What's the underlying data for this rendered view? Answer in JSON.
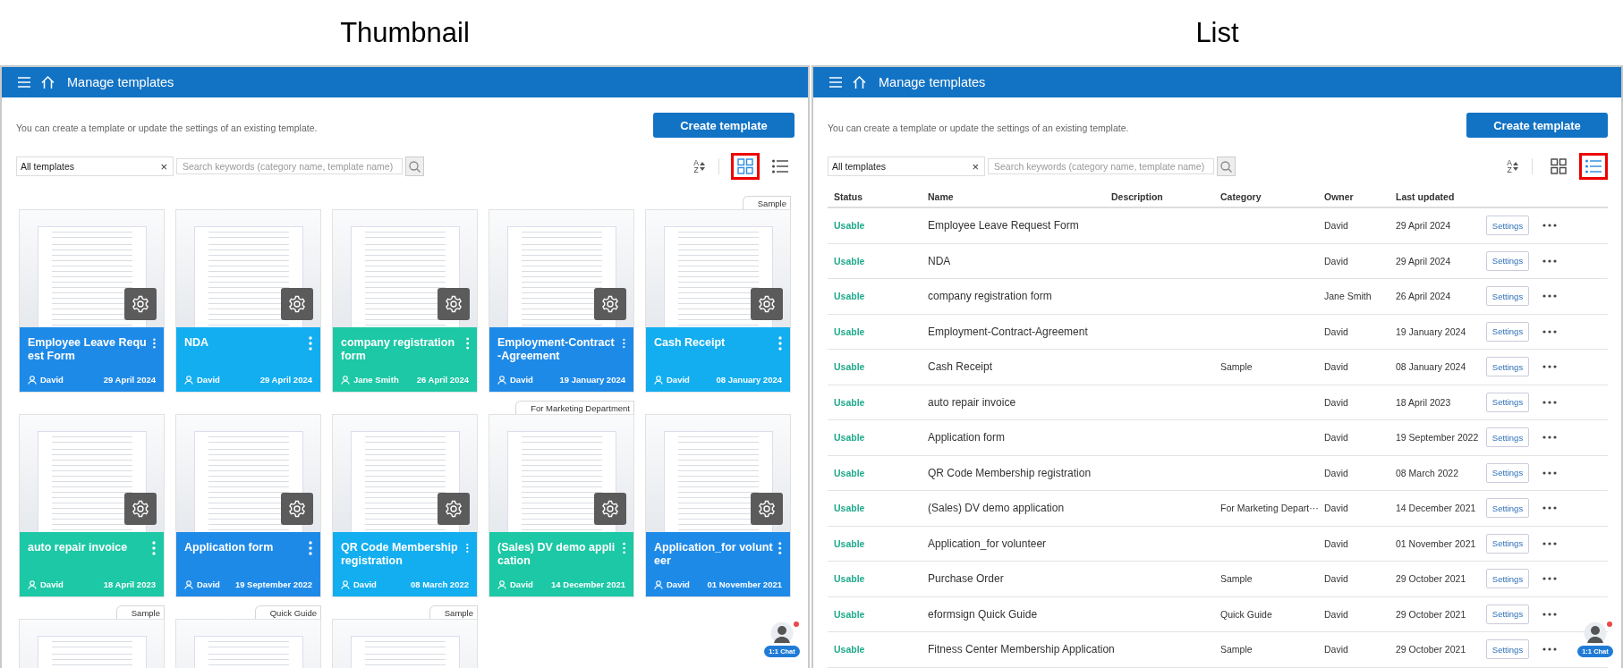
{
  "panels": [
    {
      "caption": "Thumbnail",
      "kind": "thumbnail",
      "header": {
        "title": "Manage templates"
      },
      "intro": "You can create a template or update the settings of an existing template.",
      "create_button": "Create template",
      "filter": {
        "value": "All templates",
        "clear": "×"
      },
      "search": {
        "placeholder": "Search keywords (category name, template name)"
      },
      "sort": {
        "top": "A",
        "bottom": "Z"
      },
      "view_buttons": [
        {
          "kind": "grid",
          "selected": true
        },
        {
          "kind": "list",
          "selected": false
        }
      ],
      "cards": [
        {
          "title": "Employee Leave Request Form",
          "owner": "David",
          "date": "29 April 2024",
          "color": "#1e8ae8"
        },
        {
          "title": "NDA",
          "owner": "David",
          "date": "29 April 2024",
          "color": "#12aef0"
        },
        {
          "title": "company registration form",
          "owner": "Jane Smith",
          "date": "26 April 2024",
          "color": "#1cc8a5"
        },
        {
          "title": "Employment-Contract-Agreement",
          "owner": "David",
          "date": "19 January 2024",
          "color": "#1e8ae8"
        },
        {
          "title": "Cash Receipt",
          "owner": "David",
          "date": "08 January 2024",
          "color": "#12aef0",
          "tag": "Sample"
        },
        {
          "title": "auto repair invoice",
          "owner": "David",
          "date": "18 April 2023",
          "color": "#1cc8a5"
        },
        {
          "title": "Application form",
          "owner": "David",
          "date": "19 September 2022",
          "color": "#1e8ae8"
        },
        {
          "title": "QR Code Membership registration",
          "owner": "David",
          "date": "08 March 2022",
          "color": "#12aef0"
        },
        {
          "title": "(Sales) DV demo application",
          "owner": "David",
          "date": "14 December 2021",
          "color": "#1cc8a5",
          "tag": "For Marketing Department"
        },
        {
          "title": "Application_for volunteer",
          "owner": "David",
          "date": "01 November 2021",
          "color": "#1e8ae8"
        },
        {
          "tag": "Sample"
        },
        {
          "tag": "Quick Guide"
        },
        {
          "tag": "Sample"
        }
      ],
      "chat": {
        "label": "1:1 Chat"
      }
    },
    {
      "caption": "List",
      "kind": "list",
      "header": {
        "title": "Manage templates"
      },
      "intro": "You can create a template or update the settings of an existing template.",
      "create_button": "Create template",
      "filter": {
        "value": "All templates",
        "clear": "×"
      },
      "search": {
        "placeholder": "Search keywords (category name, template name)"
      },
      "sort": {
        "top": "A",
        "bottom": "Z"
      },
      "view_buttons": [
        {
          "kind": "grid",
          "selected": false
        },
        {
          "kind": "list",
          "selected": true
        }
      ],
      "table": {
        "columns": [
          "Status",
          "Name",
          "Description",
          "Category",
          "Owner",
          "Last updated"
        ],
        "rows": [
          {
            "status": "Usable",
            "name": "Employee Leave Request Form",
            "owner": "David",
            "updated": "29 April 2024",
            "action": "Settings"
          },
          {
            "status": "Usable",
            "name": "NDA",
            "owner": "David",
            "updated": "29 April 2024",
            "action": "Settings"
          },
          {
            "status": "Usable",
            "name": "company registration form",
            "owner": "Jane Smith",
            "updated": "26 April 2024",
            "action": "Settings"
          },
          {
            "status": "Usable",
            "name": "Employment-Contract-Agreement",
            "owner": "David",
            "updated": "19 January 2024",
            "action": "Settings"
          },
          {
            "status": "Usable",
            "name": "Cash Receipt",
            "category": "Sample",
            "owner": "David",
            "updated": "08 January 2024",
            "action": "Settings"
          },
          {
            "status": "Usable",
            "name": "auto repair invoice",
            "owner": "David",
            "updated": "18 April 2023",
            "action": "Settings"
          },
          {
            "status": "Usable",
            "name": "Application form",
            "owner": "David",
            "updated": "19 September 2022",
            "action": "Settings"
          },
          {
            "status": "Usable",
            "name": "QR Code Membership registration",
            "owner": "David",
            "updated": "08 March 2022",
            "action": "Settings"
          },
          {
            "status": "Usable",
            "name": "(Sales) DV demo application",
            "category": "For Marketing Depart···",
            "owner": "David",
            "updated": "14 December 2021",
            "action": "Settings"
          },
          {
            "status": "Usable",
            "name": "Application_for volunteer",
            "owner": "David",
            "updated": "01 November 2021",
            "action": "Settings"
          },
          {
            "status": "Usable",
            "name": "Purchase Order",
            "category": "Sample",
            "owner": "David",
            "updated": "29 October 2021",
            "action": "Settings"
          },
          {
            "status": "Usable",
            "name": "eformsign Quick Guide",
            "category": "Quick Guide",
            "owner": "David",
            "updated": "29 October 2021",
            "action": "Settings"
          },
          {
            "status": "Usable",
            "name": "Fitness Center Membership Application",
            "category": "Sample",
            "owner": "David",
            "updated": "29 October 2021",
            "action": "Settings"
          }
        ]
      },
      "chat": {
        "label": "1:1 Chat"
      }
    }
  ]
}
